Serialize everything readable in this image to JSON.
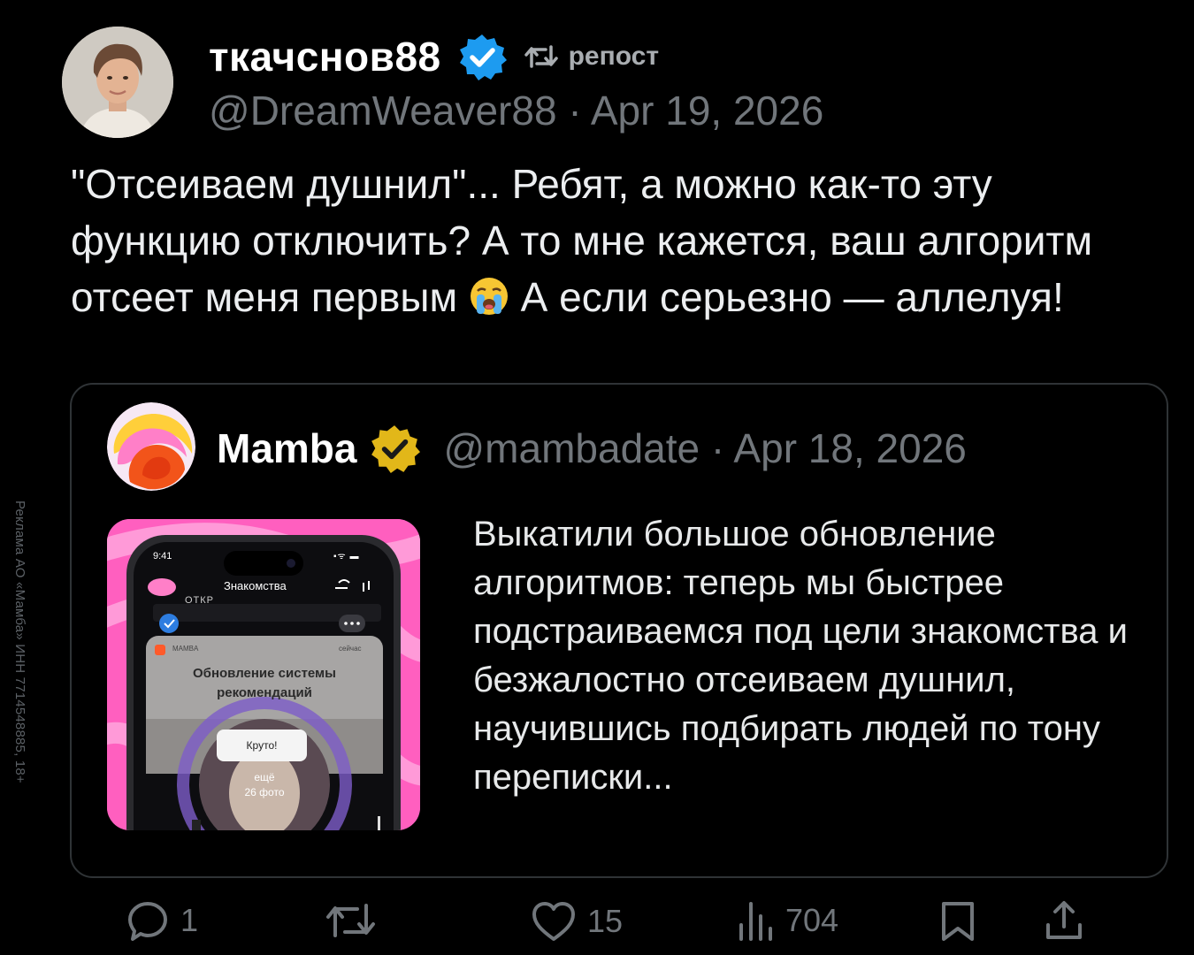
{
  "ad_disclaimer": "Реклама АО «Мамба» ИНН 7714548885, 18+",
  "post": {
    "display_name": "ткачснов88",
    "repost_label": "репост",
    "handle_date": "@DreamWeaver88 · Apr 19, 2026",
    "text_part1": "\"Отсеиваем душнил\"... Ребят, а можно как-то эту функцию отключить? А то мне кажется, ваш алгоритм отсеет меня первым ",
    "emoji_name": "loudly-crying-face-emoji",
    "text_part2": " А если серьезно — аллелуя!"
  },
  "quote": {
    "display_name": "Mamba",
    "handle_date": "@mambadate · Apr 18, 2026",
    "text": "Выкатили большое обновление алгоритмов: теперь мы быстрее подстраиваемся под цели знакомства и безжалостно отсеиваем душнил, научившись подбирать людей по тону переписки...",
    "media": {
      "time": "9:41",
      "screen_title": "Знакомства",
      "notif_app": "MAMBA",
      "notif_time": "сейчас",
      "notif_title": "Обновление системы рекомендаций",
      "notif_button": "Круто!",
      "more_photos": "ещё",
      "photos_count": "26 фото",
      "partial_header": "ОТКР"
    }
  },
  "actions": {
    "replies": "1",
    "reposts": "",
    "likes": "15",
    "views": "704"
  },
  "colors": {
    "background": "#000000",
    "secondary_text": "#71767b",
    "verified_blue": "#1d9bf0",
    "verified_gold": "#e2b719",
    "border": "#2f3336"
  }
}
